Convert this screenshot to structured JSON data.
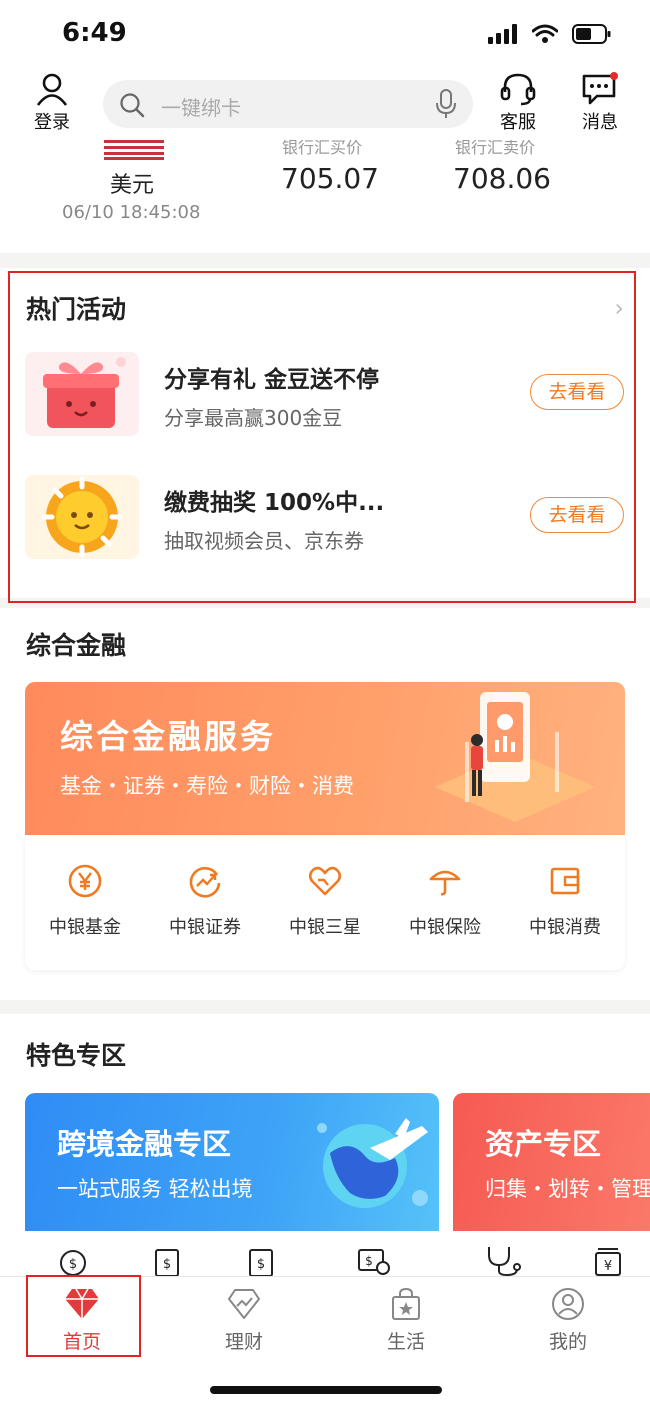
{
  "status": {
    "time": "6:49"
  },
  "header": {
    "login_label": "登录",
    "search_placeholder": "一键绑卡",
    "service_label": "客服",
    "message_label": "消息"
  },
  "fx": {
    "currency": "美元",
    "datetime": "06/10 18:45:08",
    "buy_caption": "银行汇买价",
    "buy_value": "705.07",
    "sell_caption": "银行汇卖价",
    "sell_value": "708.06"
  },
  "hot": {
    "title": "热门活动",
    "items": [
      {
        "title": "分享有礼 金豆送不停",
        "subtitle": "分享最高赢300金豆",
        "button": "去看看"
      },
      {
        "title": "缴费抽奖 100%中...",
        "subtitle": "抽取视频会员、京东券",
        "button": "去看看"
      }
    ]
  },
  "finance": {
    "title": "综合金融",
    "banner_title": "综合金融服务",
    "banner_sub": "基金・证券・寿险・财险・消费",
    "items": [
      {
        "label": "中银基金",
        "icon": "yen-circle-icon"
      },
      {
        "label": "中银证券",
        "icon": "trend-circle-icon"
      },
      {
        "label": "中银三星",
        "icon": "heart-icon"
      },
      {
        "label": "中银保险",
        "icon": "umbrella-icon"
      },
      {
        "label": "中银消费",
        "icon": "wallet-icon"
      }
    ]
  },
  "featured": {
    "title": "特色专区",
    "cards": [
      {
        "title": "跨境金融专区",
        "subtitle": "一站式服务 轻松出境"
      },
      {
        "title": "资产专区",
        "subtitle": "归集・划转・管理"
      }
    ]
  },
  "tabs": [
    {
      "label": "首页",
      "icon": "diamond-icon"
    },
    {
      "label": "理财",
      "icon": "chart-diamond-icon"
    },
    {
      "label": "生活",
      "icon": "shopping-bag-icon"
    },
    {
      "label": "我的",
      "icon": "user-icon"
    }
  ],
  "colors": {
    "accent": "#e23b3b",
    "orange": "#f07a22",
    "highlight_box": "#e02424"
  }
}
